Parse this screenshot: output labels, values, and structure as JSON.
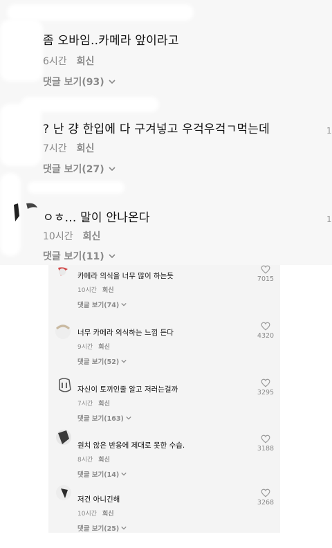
{
  "top_panel": {
    "comments": [
      {
        "text": "좀 오바임..카메라 앞이라고",
        "time": "6시간",
        "reply_label": "회신",
        "view_replies": "댓글 보기(93)"
      },
      {
        "text": "? 난 걍 한입에 다 구겨넣고 우걱우걱ㄱ먹는데",
        "time": "7시간",
        "reply_label": "회신",
        "view_replies": "댓글 보기(27)",
        "edge_like_fragment": "1"
      },
      {
        "text": "ㅇㅎ... 말이 안나온다",
        "time": "10시간",
        "reply_label": "회신",
        "view_replies": "댓글 보기(11)",
        "edge_like_fragment": "1"
      }
    ]
  },
  "bottom_panel": {
    "comments": [
      {
        "text": "카메라 의식을 너무 많이 하는듯",
        "time": "10시간",
        "reply_label": "회신",
        "view_replies": "댓글 보기(74)",
        "likes": "7015"
      },
      {
        "text": "너무 카메라 의식하는 느낌 든다",
        "time": "9시간",
        "reply_label": "회신",
        "view_replies": "댓글 보기(52)",
        "likes": "4320"
      },
      {
        "text": "자신이 토끼인줄 알고 저러는걸까",
        "time": "7시간",
        "reply_label": "회신",
        "view_replies": "댓글 보기(163)",
        "likes": "3295"
      },
      {
        "text": "원치 않은 반응에 제대로 못한 수습.",
        "time": "8시간",
        "reply_label": "회신",
        "view_replies": "댓글 보기(14)",
        "likes": "3188"
      },
      {
        "text": "저건 아니긴해",
        "time": "10시간",
        "reply_label": "회신",
        "view_replies": "댓글 보기(25)",
        "likes": "3268"
      }
    ]
  },
  "icons": {
    "like": "heart-outline-icon",
    "expand": "chevron-down-icon"
  },
  "colors": {
    "text": "#111111",
    "muted": "#8a8a8a",
    "top_bg": "#f7f7f7",
    "bottom_bg": "#f4f4f4"
  }
}
